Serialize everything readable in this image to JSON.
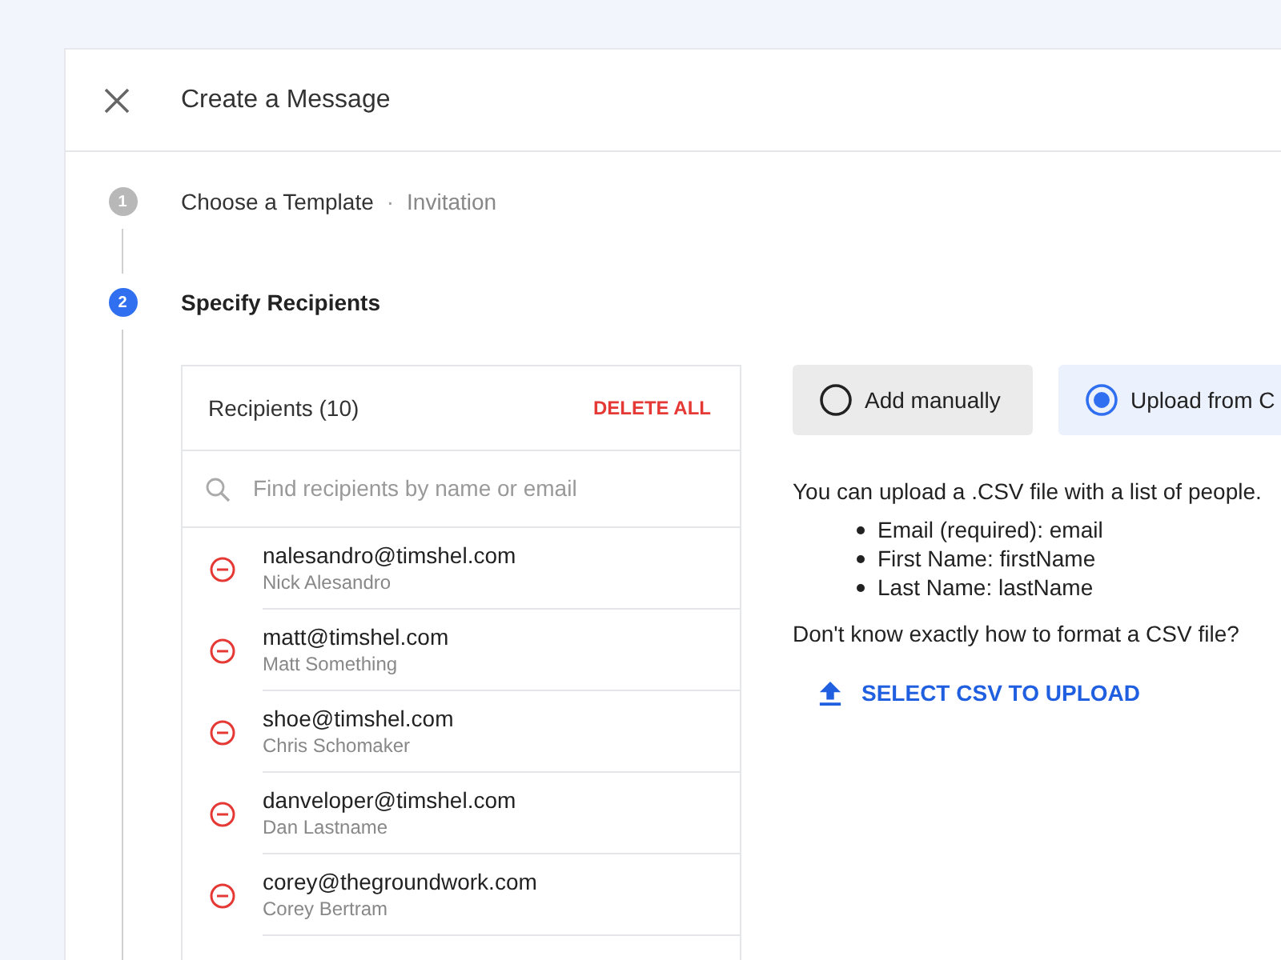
{
  "dialog": {
    "title": "Create a Message"
  },
  "steps": [
    {
      "number": "1",
      "title": "Choose a Template",
      "separator": "·",
      "detail": "Invitation",
      "active": false
    },
    {
      "number": "2",
      "title": "Specify Recipients",
      "active": true
    }
  ],
  "recipients": {
    "heading": "Recipients (10)",
    "delete_all": "DELETE ALL",
    "search": {
      "placeholder": "Find recipients by name or email"
    },
    "items": [
      {
        "email": "nalesandro@timshel.com",
        "name": "Nick Alesandro"
      },
      {
        "email": "matt@timshel.com",
        "name": "Matt Something"
      },
      {
        "email": "shoe@timshel.com",
        "name": "Chris Schomaker"
      },
      {
        "email": "danveloper@timshel.com",
        "name": "Dan Lastname"
      },
      {
        "email": "corey@thegroundwork.com",
        "name": "Corey Bertram"
      }
    ]
  },
  "methods": [
    {
      "label": "Add manually",
      "selected": false
    },
    {
      "label": "Upload from C",
      "selected": true
    }
  ],
  "upload": {
    "intro": "You can upload a .CSV file with a list of people.",
    "fields": [
      "Email (required): email",
      "First Name: firstName",
      "Last Name: lastName"
    ],
    "help": "Don't know exactly how to format a CSV file?",
    "button": "SELECT CSV TO UPLOAD"
  }
}
